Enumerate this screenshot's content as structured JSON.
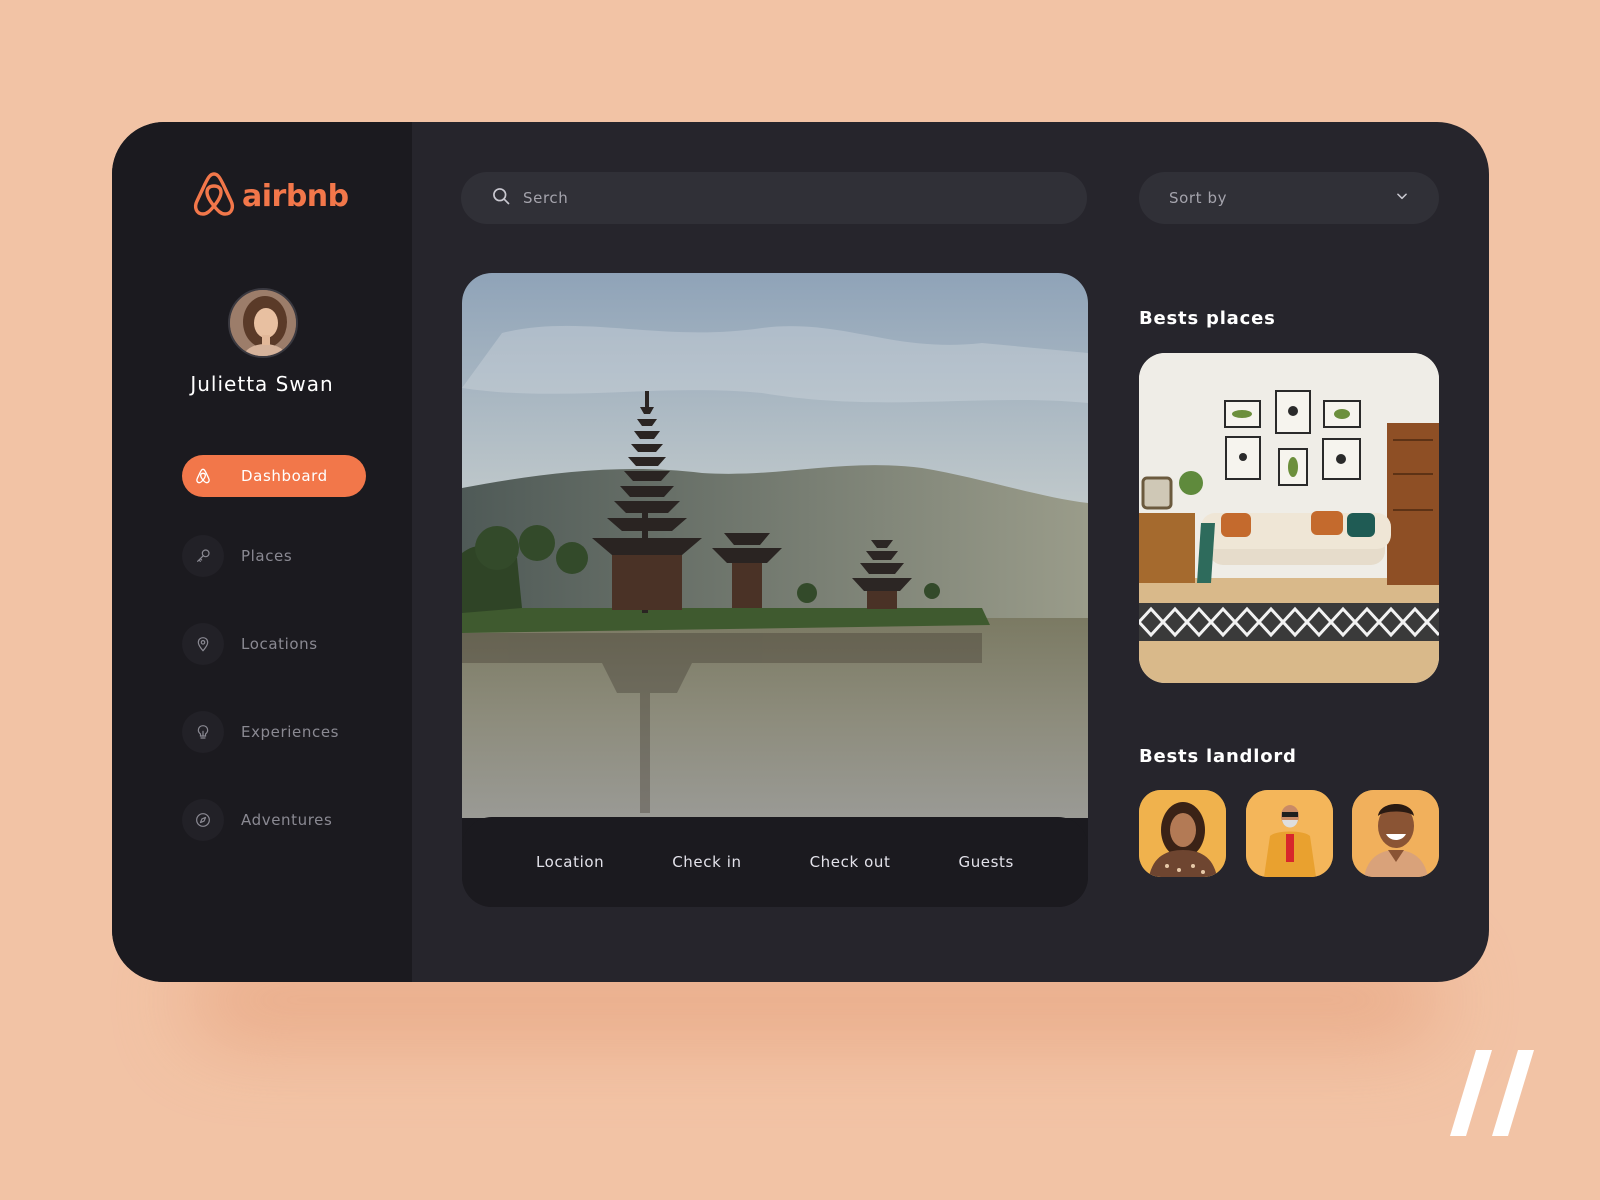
{
  "brand": {
    "name": "airbnb",
    "accent_color": "#f2774a",
    "logo_icon": "airbnb-logo-icon"
  },
  "user": {
    "name": "Julietta Swan",
    "avatar_icon": "user-avatar"
  },
  "nav": {
    "items": [
      {
        "label": "Dashboard",
        "icon": "airbnb-icon",
        "active": true
      },
      {
        "label": "Places",
        "icon": "key-icon",
        "active": false
      },
      {
        "label": "Locations",
        "icon": "location-pin-icon",
        "active": false
      },
      {
        "label": "Experiences",
        "icon": "lightbulb-icon",
        "active": false
      },
      {
        "label": "Adventures",
        "icon": "compass-icon",
        "active": false
      }
    ]
  },
  "search": {
    "placeholder": "Serch",
    "icon": "search-icon"
  },
  "sort": {
    "label": "Sort by",
    "icon": "chevron-down-icon"
  },
  "hero": {
    "image": "temple-on-lake-photo"
  },
  "booking": {
    "fields": [
      "Location",
      "Check in",
      "Check out",
      "Guests"
    ]
  },
  "best_places": {
    "title": "Bests places",
    "image": "living-room-photo"
  },
  "best_landlord": {
    "title": "Bests landlord",
    "people": [
      "landlord-woman-photo",
      "landlord-man-sunglasses-photo",
      "landlord-man-smiling-photo"
    ]
  },
  "colors": {
    "background": "#f2c3a5",
    "panel": "#26252c",
    "sidebar": "#1b1a1f",
    "accent": "#f2774a"
  }
}
